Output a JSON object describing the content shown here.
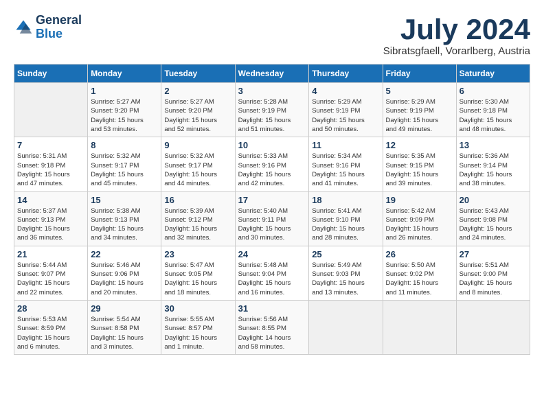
{
  "header": {
    "logo_line1": "General",
    "logo_line2": "Blue",
    "month": "July 2024",
    "location": "Sibratsgfaell, Vorarlberg, Austria"
  },
  "columns": [
    "Sunday",
    "Monday",
    "Tuesday",
    "Wednesday",
    "Thursday",
    "Friday",
    "Saturday"
  ],
  "weeks": [
    [
      {
        "day": "",
        "info": ""
      },
      {
        "day": "1",
        "info": "Sunrise: 5:27 AM\nSunset: 9:20 PM\nDaylight: 15 hours\nand 53 minutes."
      },
      {
        "day": "2",
        "info": "Sunrise: 5:27 AM\nSunset: 9:20 PM\nDaylight: 15 hours\nand 52 minutes."
      },
      {
        "day": "3",
        "info": "Sunrise: 5:28 AM\nSunset: 9:19 PM\nDaylight: 15 hours\nand 51 minutes."
      },
      {
        "day": "4",
        "info": "Sunrise: 5:29 AM\nSunset: 9:19 PM\nDaylight: 15 hours\nand 50 minutes."
      },
      {
        "day": "5",
        "info": "Sunrise: 5:29 AM\nSunset: 9:19 PM\nDaylight: 15 hours\nand 49 minutes."
      },
      {
        "day": "6",
        "info": "Sunrise: 5:30 AM\nSunset: 9:18 PM\nDaylight: 15 hours\nand 48 minutes."
      }
    ],
    [
      {
        "day": "7",
        "info": "Sunrise: 5:31 AM\nSunset: 9:18 PM\nDaylight: 15 hours\nand 47 minutes."
      },
      {
        "day": "8",
        "info": "Sunrise: 5:32 AM\nSunset: 9:17 PM\nDaylight: 15 hours\nand 45 minutes."
      },
      {
        "day": "9",
        "info": "Sunrise: 5:32 AM\nSunset: 9:17 PM\nDaylight: 15 hours\nand 44 minutes."
      },
      {
        "day": "10",
        "info": "Sunrise: 5:33 AM\nSunset: 9:16 PM\nDaylight: 15 hours\nand 42 minutes."
      },
      {
        "day": "11",
        "info": "Sunrise: 5:34 AM\nSunset: 9:16 PM\nDaylight: 15 hours\nand 41 minutes."
      },
      {
        "day": "12",
        "info": "Sunrise: 5:35 AM\nSunset: 9:15 PM\nDaylight: 15 hours\nand 39 minutes."
      },
      {
        "day": "13",
        "info": "Sunrise: 5:36 AM\nSunset: 9:14 PM\nDaylight: 15 hours\nand 38 minutes."
      }
    ],
    [
      {
        "day": "14",
        "info": "Sunrise: 5:37 AM\nSunset: 9:13 PM\nDaylight: 15 hours\nand 36 minutes."
      },
      {
        "day": "15",
        "info": "Sunrise: 5:38 AM\nSunset: 9:13 PM\nDaylight: 15 hours\nand 34 minutes."
      },
      {
        "day": "16",
        "info": "Sunrise: 5:39 AM\nSunset: 9:12 PM\nDaylight: 15 hours\nand 32 minutes."
      },
      {
        "day": "17",
        "info": "Sunrise: 5:40 AM\nSunset: 9:11 PM\nDaylight: 15 hours\nand 30 minutes."
      },
      {
        "day": "18",
        "info": "Sunrise: 5:41 AM\nSunset: 9:10 PM\nDaylight: 15 hours\nand 28 minutes."
      },
      {
        "day": "19",
        "info": "Sunrise: 5:42 AM\nSunset: 9:09 PM\nDaylight: 15 hours\nand 26 minutes."
      },
      {
        "day": "20",
        "info": "Sunrise: 5:43 AM\nSunset: 9:08 PM\nDaylight: 15 hours\nand 24 minutes."
      }
    ],
    [
      {
        "day": "21",
        "info": "Sunrise: 5:44 AM\nSunset: 9:07 PM\nDaylight: 15 hours\nand 22 minutes."
      },
      {
        "day": "22",
        "info": "Sunrise: 5:46 AM\nSunset: 9:06 PM\nDaylight: 15 hours\nand 20 minutes."
      },
      {
        "day": "23",
        "info": "Sunrise: 5:47 AM\nSunset: 9:05 PM\nDaylight: 15 hours\nand 18 minutes."
      },
      {
        "day": "24",
        "info": "Sunrise: 5:48 AM\nSunset: 9:04 PM\nDaylight: 15 hours\nand 16 minutes."
      },
      {
        "day": "25",
        "info": "Sunrise: 5:49 AM\nSunset: 9:03 PM\nDaylight: 15 hours\nand 13 minutes."
      },
      {
        "day": "26",
        "info": "Sunrise: 5:50 AM\nSunset: 9:02 PM\nDaylight: 15 hours\nand 11 minutes."
      },
      {
        "day": "27",
        "info": "Sunrise: 5:51 AM\nSunset: 9:00 PM\nDaylight: 15 hours\nand 8 minutes."
      }
    ],
    [
      {
        "day": "28",
        "info": "Sunrise: 5:53 AM\nSunset: 8:59 PM\nDaylight: 15 hours\nand 6 minutes."
      },
      {
        "day": "29",
        "info": "Sunrise: 5:54 AM\nSunset: 8:58 PM\nDaylight: 15 hours\nand 3 minutes."
      },
      {
        "day": "30",
        "info": "Sunrise: 5:55 AM\nSunset: 8:57 PM\nDaylight: 15 hours\nand 1 minute."
      },
      {
        "day": "31",
        "info": "Sunrise: 5:56 AM\nSunset: 8:55 PM\nDaylight: 14 hours\nand 58 minutes."
      },
      {
        "day": "",
        "info": ""
      },
      {
        "day": "",
        "info": ""
      },
      {
        "day": "",
        "info": ""
      }
    ]
  ]
}
